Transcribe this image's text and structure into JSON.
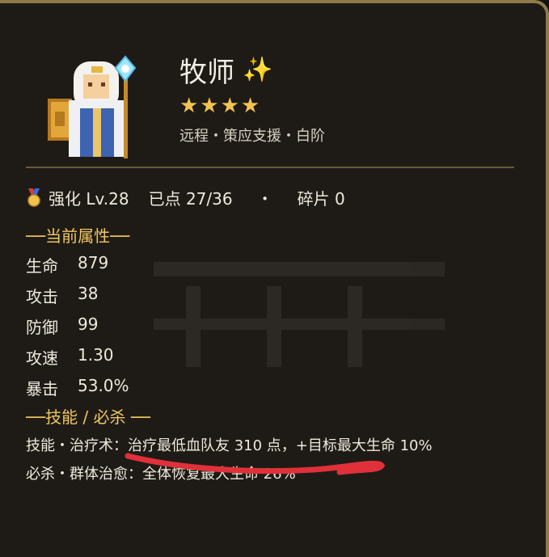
{
  "hero": {
    "name": "牧师",
    "name_icon": "sparkle-emoji",
    "name_icon_glyph": "✨",
    "stars": "★★★★",
    "tags": "远程・策应支援・白阶"
  },
  "upgrade": {
    "medal_icon": "medal-icon",
    "level": "强化 Lv.28",
    "points": "已点 27/36",
    "dot": "・",
    "shards": "碎片 0"
  },
  "attributes": {
    "header": "──当前属性──",
    "rows": [
      {
        "label": "生命",
        "value": "879"
      },
      {
        "label": "攻击",
        "value": "38"
      },
      {
        "label": "防御",
        "value": "99"
      },
      {
        "label": "攻速",
        "value": "1.30"
      },
      {
        "label": "暴击",
        "value": "53.0%"
      }
    ]
  },
  "skills": {
    "header": "──技能 / 必杀 ──",
    "skill": "技能・治疗术：治疗最低血队友 310 点，+目标最大生命 10%",
    "ultimate": "必杀・群体治愈：全体恢复最大生命 26%"
  },
  "colors": {
    "panel_bg": "#1e1b17",
    "border_gold": "#8f7b4a",
    "accent_gold": "#f0c75e",
    "text": "#efe9dc",
    "annotation_red": "#e0303a"
  }
}
